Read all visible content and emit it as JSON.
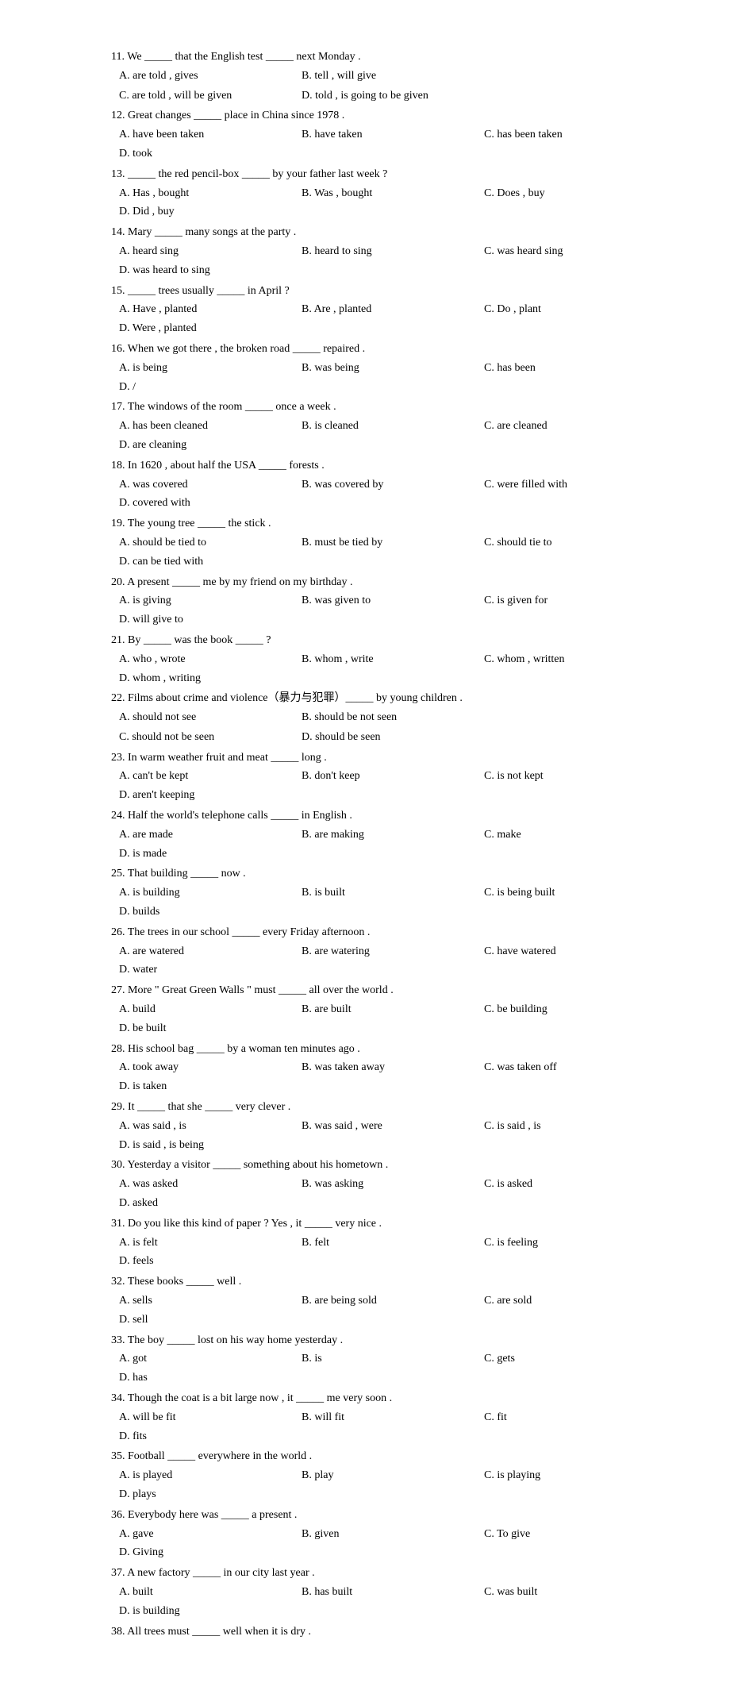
{
  "questions": [
    {
      "id": 11,
      "text": "11. We _____ that the English test _____ next Monday .",
      "options_rows": [
        [
          "A. are told , gives",
          "B. tell , will give"
        ],
        [
          "C. are told , will be given",
          "D. told , is going to be given"
        ]
      ]
    },
    {
      "id": 12,
      "text": "12. Great changes _____ place in China since 1978 .",
      "options_rows": [
        [
          "A. have been taken",
          "B. have taken",
          "C. has been taken",
          "D. took"
        ]
      ]
    },
    {
      "id": 13,
      "text": "13. _____ the red pencil-box _____ by your father last week ?",
      "options_rows": [
        [
          "A. Has , bought",
          "B. Was , bought",
          "C. Does , buy",
          "D. Did , buy"
        ]
      ]
    },
    {
      "id": 14,
      "text": "14. Mary _____ many songs at the party .",
      "options_rows": [
        [
          "A. heard sing",
          "B. heard to sing",
          "C. was heard sing",
          "D. was heard to sing"
        ]
      ]
    },
    {
      "id": 15,
      "text": "15. _____ trees usually _____ in April ?",
      "options_rows": [
        [
          "A. Have , planted",
          "B. Are , planted",
          "C. Do , plant",
          "D. Were , planted"
        ]
      ]
    },
    {
      "id": 16,
      "text": "16. When we got there , the broken road _____ repaired .",
      "options_rows": [
        [
          "A. is being",
          "B. was being",
          "C. has been",
          "D. /"
        ]
      ]
    },
    {
      "id": 17,
      "text": "17. The windows of the room _____ once a week .",
      "options_rows": [
        [
          "A. has been cleaned",
          "B. is cleaned",
          "C. are cleaned",
          "D. are cleaning"
        ]
      ]
    },
    {
      "id": 18,
      "text": "18. In 1620 , about half the USA _____ forests .",
      "options_rows": [
        [
          "A. was covered",
          "B. was covered by",
          "C. were filled with",
          "D. covered with"
        ]
      ]
    },
    {
      "id": 19,
      "text": "19. The young tree _____ the stick .",
      "options_rows": [
        [
          "A. should be tied to",
          "B. must be tied by",
          "C. should tie to",
          "D. can be tied with"
        ]
      ]
    },
    {
      "id": 20,
      "text": "20. A present _____ me by my friend on my birthday .",
      "options_rows": [
        [
          "A. is giving",
          "B. was given to",
          "C. is given for",
          "D. will give to"
        ]
      ]
    },
    {
      "id": 21,
      "text": "21. By _____ was the book _____ ?",
      "options_rows": [
        [
          "A. who , wrote",
          "B. whom , write",
          "C. whom , written",
          "D. whom , writing"
        ]
      ]
    },
    {
      "id": 22,
      "text": "22. Films about crime and violence（暴力与犯罪）_____ by young children .",
      "options_rows": [
        [
          "A. should not see",
          "B. should be not seen"
        ],
        [
          "C. should not be seen",
          "D. should be seen"
        ]
      ]
    },
    {
      "id": 23,
      "text": "23. In warm weather fruit and meat _____ long .",
      "options_rows": [
        [
          "A. can't be kept",
          "B. don't keep",
          "C. is not kept",
          "D. aren't keeping"
        ]
      ]
    },
    {
      "id": 24,
      "text": "24. Half the world's telephone calls _____ in English .",
      "options_rows": [
        [
          "A. are made",
          "B. are making",
          "C. make",
          "D. is made"
        ]
      ]
    },
    {
      "id": 25,
      "text": "25. That building _____ now .",
      "options_rows": [
        [
          "A. is building",
          "B. is built",
          "C. is being built",
          "D. builds"
        ]
      ]
    },
    {
      "id": 26,
      "text": "26. The trees in our school _____ every Friday afternoon .",
      "options_rows": [
        [
          "A. are watered",
          "B. are watering",
          "C. have watered",
          "D. water"
        ]
      ]
    },
    {
      "id": 27,
      "text": "27. More \" Great Green Walls \" must _____ all over the world .",
      "options_rows": [
        [
          "A. build",
          "B. are built",
          "C. be building",
          "D. be built"
        ]
      ]
    },
    {
      "id": 28,
      "text": "28. His school bag _____ by a woman ten minutes ago .",
      "options_rows": [
        [
          "A. took away",
          "B. was taken away",
          "C. was taken off",
          "D. is taken"
        ]
      ]
    },
    {
      "id": 29,
      "text": "29. It _____ that she _____ very clever .",
      "options_rows": [
        [
          "A. was said , is",
          "B. was said , were",
          "C. is said , is",
          "D. is said , is being"
        ]
      ]
    },
    {
      "id": 30,
      "text": "30. Yesterday a visitor _____ something about his hometown .",
      "options_rows": [
        [
          "A. was asked",
          "B. was asking",
          "C. is asked",
          "D. asked"
        ]
      ]
    },
    {
      "id": 31,
      "text": "31. Do you like this kind of paper ? Yes , it _____ very nice .",
      "options_rows": [
        [
          "A. is felt",
          "B. felt",
          "C. is feeling",
          "D. feels"
        ]
      ]
    },
    {
      "id": 32,
      "text": "32. These books _____ well .",
      "options_rows": [
        [
          "A. sells",
          "B. are being sold",
          "C. are sold",
          "D. sell"
        ]
      ]
    },
    {
      "id": 33,
      "text": "33. The boy _____ lost on his way home yesterday .",
      "options_rows": [
        [
          "A. got",
          "B. is",
          "C. gets",
          "D. has"
        ]
      ]
    },
    {
      "id": 34,
      "text": "34. Though the coat is a bit large now , it _____ me very soon .",
      "options_rows": [
        [
          "A. will be fit",
          "B. will fit",
          "C. fit",
          "D. fits"
        ]
      ]
    },
    {
      "id": 35,
      "text": "35. Football _____ everywhere in the world .",
      "options_rows": [
        [
          "A. is played",
          "B. play",
          "C. is playing",
          "D. plays"
        ]
      ]
    },
    {
      "id": 36,
      "text": "36. Everybody here was _____ a present .",
      "options_rows": [
        [
          "A. gave",
          "B. given",
          "C. To give",
          "D. Giving"
        ]
      ]
    },
    {
      "id": 37,
      "text": "37. A new factory _____ in our city last year .",
      "options_rows": [
        [
          "A. built",
          "B. has built",
          "C. was built",
          "D. is building"
        ]
      ]
    },
    {
      "id": 38,
      "text": "38. All trees must _____ well when it is dry .",
      "options_rows": [
        []
      ]
    }
  ]
}
